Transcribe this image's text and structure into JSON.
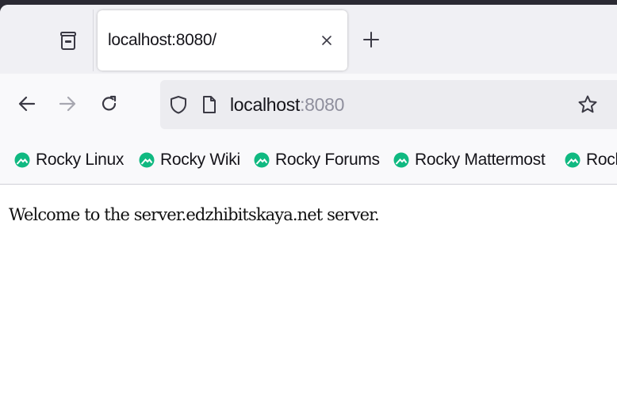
{
  "tab": {
    "title": "localhost:8080/"
  },
  "urlbar": {
    "host": "localhost",
    "port": ":8080"
  },
  "bookmarks": [
    {
      "label": "Rocky Linux"
    },
    {
      "label": "Rocky Wiki"
    },
    {
      "label": "Rocky Forums"
    },
    {
      "label": "Rocky Mattermost"
    },
    {
      "label": "Rock"
    }
  ],
  "page": {
    "text": "Welcome to the server.edzhibitskaya.net server."
  },
  "icons": {
    "tab_list": "firefox-view-icon",
    "close": "close-icon",
    "new_tab": "plus-icon",
    "back": "arrow-left-icon",
    "forward": "arrow-right-icon",
    "reload": "reload-icon",
    "tracking": "shield-icon",
    "page_info": "page-icon",
    "bookmark": "star-icon",
    "bookmark_favicon": "rocky-logo-icon"
  },
  "colors": {
    "rocky_green": "#10b981",
    "port_grey": "#8f8f9d"
  }
}
